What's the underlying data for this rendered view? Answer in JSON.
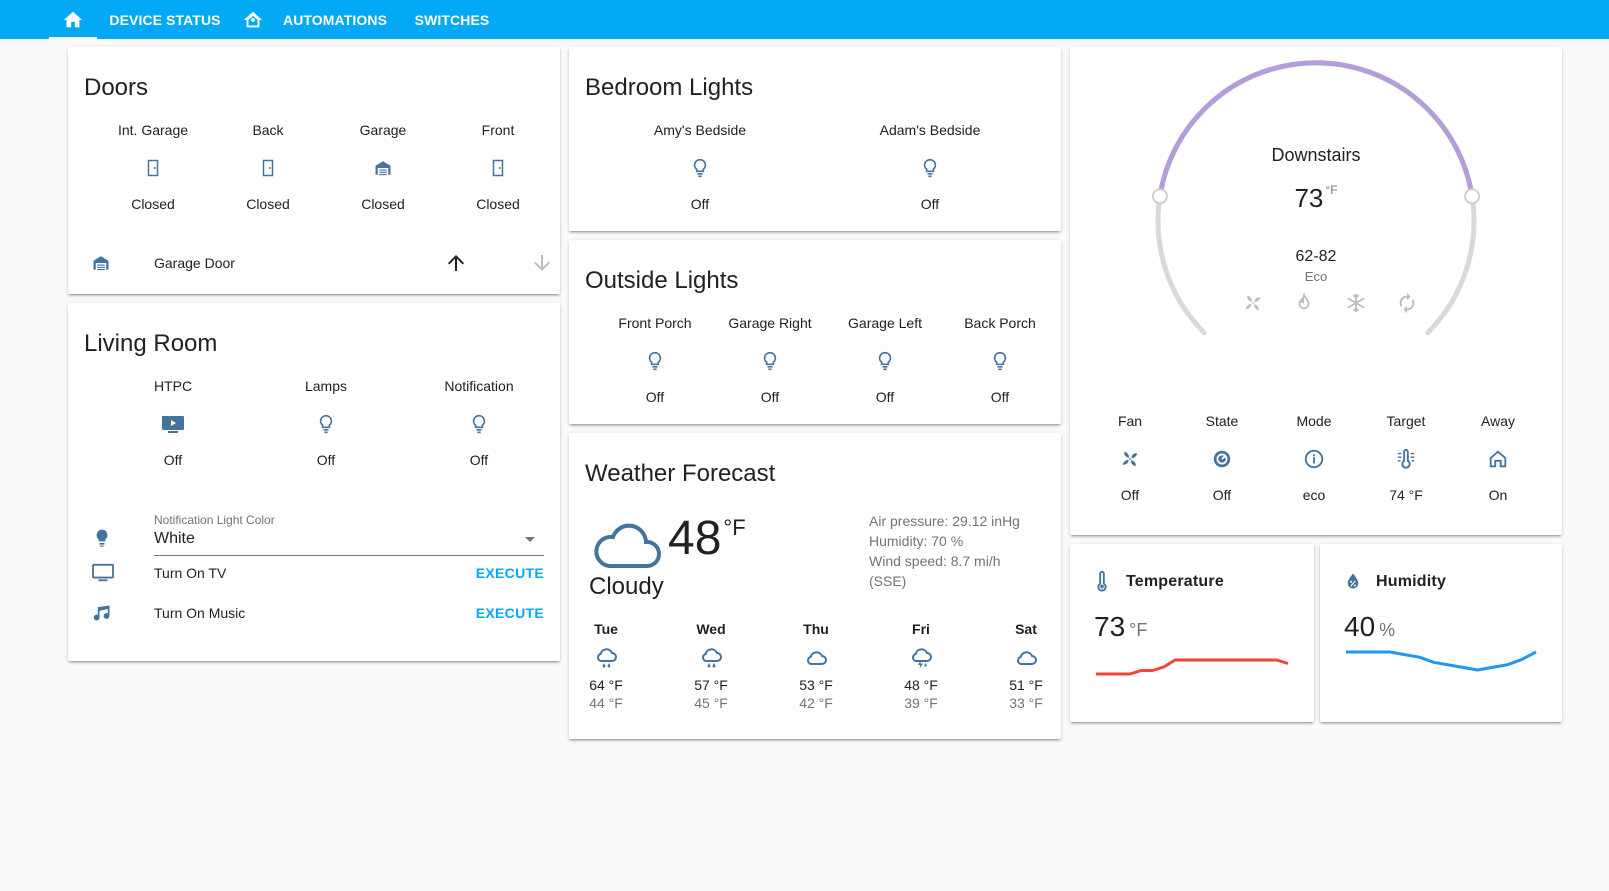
{
  "topbar": {
    "tabs": [
      {
        "label": "DEVICE STATUS"
      },
      {
        "label": "AUTOMATIONS"
      },
      {
        "label": "SWITCHES"
      }
    ]
  },
  "doors": {
    "title": "Doors",
    "entities": [
      {
        "name": "Int. Garage",
        "state": "Closed"
      },
      {
        "name": "Back",
        "state": "Closed"
      },
      {
        "name": "Garage",
        "state": "Closed"
      },
      {
        "name": "Front",
        "state": "Closed"
      }
    ],
    "cover_row": {
      "label": "Garage Door"
    }
  },
  "living_room": {
    "title": "Living Room",
    "entities": [
      {
        "name": "HTPC",
        "state": "Off"
      },
      {
        "name": "Lamps",
        "state": "Off"
      },
      {
        "name": "Notification",
        "state": "Off"
      }
    ],
    "select": {
      "label": "Notification Light Color",
      "value": "White"
    },
    "scripts": [
      {
        "label": "Turn On TV",
        "action": "EXECUTE"
      },
      {
        "label": "Turn On Music",
        "action": "EXECUTE"
      }
    ]
  },
  "bedroom_lights": {
    "title": "Bedroom Lights",
    "entities": [
      {
        "name": "Amy's Bedside",
        "state": "Off"
      },
      {
        "name": "Adam's Bedside",
        "state": "Off"
      }
    ]
  },
  "outside_lights": {
    "title": "Outside Lights",
    "entities": [
      {
        "name": "Front Porch",
        "state": "Off"
      },
      {
        "name": "Garage Right",
        "state": "Off"
      },
      {
        "name": "Garage Left",
        "state": "Off"
      },
      {
        "name": "Back Porch",
        "state": "Off"
      }
    ]
  },
  "weather": {
    "title": "Weather Forecast",
    "temperature": "48",
    "unit": "°F",
    "condition": "Cloudy",
    "pressure": "Air pressure: 29.12 inHg",
    "humidity": "Humidity: 70 %",
    "wind": "Wind speed: 8.7 mi/h (SSE)",
    "forecast": [
      {
        "day": "Tue",
        "hi": "64 °F",
        "lo": "44 °F",
        "icon": "rainy-icon"
      },
      {
        "day": "Wed",
        "hi": "57 °F",
        "lo": "45 °F",
        "icon": "rainy-icon"
      },
      {
        "day": "Thu",
        "hi": "53 °F",
        "lo": "42 °F",
        "icon": "cloudy-icon"
      },
      {
        "day": "Fri",
        "hi": "48 °F",
        "lo": "39 °F",
        "icon": "lightning-rainy-icon"
      },
      {
        "day": "Sat",
        "hi": "51 °F",
        "lo": "33 °F",
        "icon": "cloudy-icon"
      }
    ]
  },
  "thermostat": {
    "name": "Downstairs",
    "current": "73",
    "unit": "°F",
    "range": "62-82",
    "mode": "Eco",
    "low_setpoint_fraction": 0.2,
    "high_setpoint_fraction": 0.8,
    "attributes": [
      {
        "name": "Fan",
        "state": "Off"
      },
      {
        "name": "State",
        "state": "Off"
      },
      {
        "name": "Mode",
        "state": "eco"
      },
      {
        "name": "Target",
        "state": "74 °F"
      },
      {
        "name": "Away",
        "state": "On"
      }
    ]
  },
  "temperature_sensor": {
    "name": "Temperature",
    "value": "73",
    "unit": "°F",
    "history": [
      66,
      66,
      66,
      66,
      67,
      67,
      68,
      70,
      70,
      70,
      70,
      70,
      70,
      70,
      70,
      70,
      70,
      69
    ]
  },
  "humidity_sensor": {
    "name": "Humidity",
    "value": "40",
    "unit": "%",
    "history": [
      41,
      41,
      41,
      41,
      40.5,
      40,
      39,
      38.5,
      38,
      37.5,
      38,
      38.5,
      39.5,
      41
    ]
  },
  "colors": {
    "primary": "#03a9f4",
    "icon": "#44739e",
    "temperature_line": "#f44336",
    "humidity_line": "#2196f3",
    "thermostat_arc": "#b39ddb"
  }
}
